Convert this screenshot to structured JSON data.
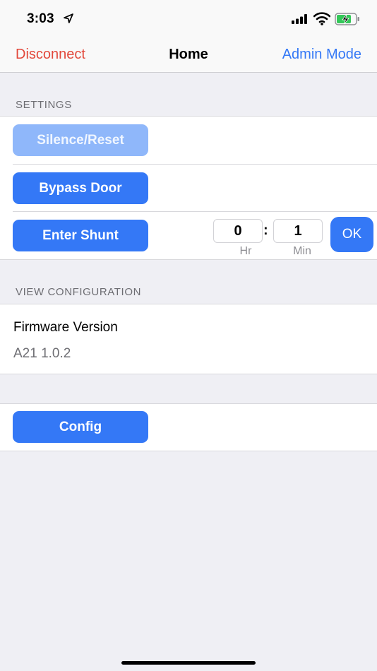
{
  "status_bar": {
    "time": "3:03"
  },
  "nav": {
    "left_label": "Disconnect",
    "title": "Home",
    "right_label": "Admin Mode"
  },
  "settings": {
    "header": "SETTINGS",
    "silence_reset_label": "Silence/Reset",
    "silence_reset_enabled": false,
    "bypass_door_label": "Bypass Door",
    "enter_shunt_label": "Enter Shunt",
    "shunt_hours": "0",
    "shunt_minutes": "1",
    "time_separator": ":",
    "hours_label": "Hr",
    "minutes_label": "Min",
    "ok_label": "OK"
  },
  "configuration": {
    "header": "VIEW CONFIGURATION",
    "firmware_title": "Firmware Version",
    "firmware_value": "A21 1.0.2"
  },
  "config": {
    "button_label": "Config"
  },
  "colors": {
    "accent": "#3478f6",
    "accent_disabled": "#8fb7fa",
    "destructive": "#e2483b",
    "background": "#efeff4"
  }
}
